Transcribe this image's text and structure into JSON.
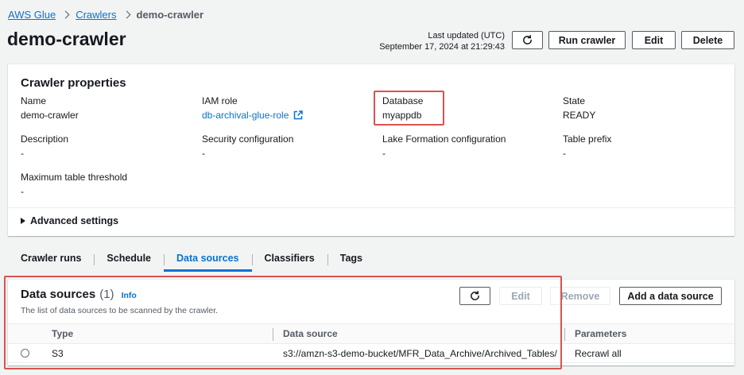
{
  "breadcrumb": {
    "items": [
      "AWS Glue",
      "Crawlers"
    ],
    "current": "demo-crawler"
  },
  "page": {
    "title": "demo-crawler"
  },
  "last_updated": {
    "label": "Last updated (UTC)",
    "value": "September 17, 2024 at 21:29:43"
  },
  "header_actions": {
    "run": "Run crawler",
    "edit": "Edit",
    "delete": "Delete",
    "refresh_icon": "refresh-icon"
  },
  "properties": {
    "title": "Crawler properties",
    "name": {
      "label": "Name",
      "value": "demo-crawler"
    },
    "iam_role": {
      "label": "IAM role",
      "value": "db-archival-glue-role",
      "icon": "external-link-icon"
    },
    "database": {
      "label": "Database",
      "value": "myappdb"
    },
    "state": {
      "label": "State",
      "value": "READY"
    },
    "description": {
      "label": "Description",
      "value": "-"
    },
    "security": {
      "label": "Security configuration",
      "value": "-"
    },
    "lake_formation": {
      "label": "Lake Formation configuration",
      "value": "-"
    },
    "table_prefix": {
      "label": "Table prefix",
      "value": "-"
    },
    "max_table": {
      "label": "Maximum table threshold",
      "value": "-"
    },
    "advanced": "Advanced settings"
  },
  "tabs": [
    "Crawler runs",
    "Schedule",
    "Data sources",
    "Classifiers",
    "Tags"
  ],
  "active_tab": "Data sources",
  "data_sources": {
    "title": "Data sources",
    "count": "(1)",
    "info": "Info",
    "description": "The list of data sources to be scanned by the crawler.",
    "actions": {
      "edit": "Edit",
      "remove": "Remove",
      "add": "Add a data source"
    },
    "columns": [
      "Type",
      "Data source",
      "Parameters"
    ],
    "rows": [
      {
        "type": "S3",
        "source": "s3://amzn-s3-demo-bucket/MFR_Data_Archive/Archived_Tables/",
        "params": "Recrawl all"
      }
    ]
  },
  "colors": {
    "link": "#0972d3",
    "highlight": "#d9534f",
    "background": "#f2f3f3"
  }
}
